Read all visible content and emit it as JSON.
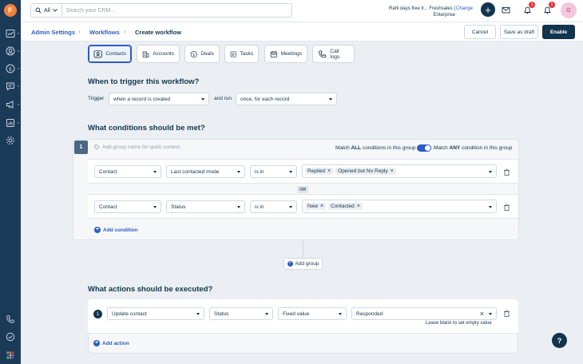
{
  "app": {
    "logo_letter": "F"
  },
  "topbar": {
    "search_scope": "All",
    "search_placeholder": "Search your CRM...",
    "trial_line1": "Rahi days free tr...",
    "trial_line2": "Freshsales |",
    "trial_line3": "Enterprise",
    "change_label": "Change",
    "plus_label": "+",
    "notifications_badge": "1",
    "alerts_badge": "1",
    "avatar_initial": "G"
  },
  "breadcrumb": {
    "admin_settings": "Admin Settings",
    "workflows": "Workflows",
    "current": "Create workflow",
    "sep": "›"
  },
  "header_buttons": {
    "cancel": "Cancel",
    "save_draft": "Save as draft",
    "enable": "Enable"
  },
  "modules": [
    {
      "label": "Contacts",
      "icon": "contacts-icon"
    },
    {
      "label": "Accounts",
      "icon": "accounts-icon"
    },
    {
      "label": "Deals",
      "icon": "deals-icon"
    },
    {
      "label": "Tasks",
      "icon": "tasks-icon"
    },
    {
      "label": "Meetings",
      "icon": "meetings-icon"
    },
    {
      "label": "Call logs",
      "icon": "call-logs-icon"
    }
  ],
  "trigger": {
    "title": "When to trigger this workflow?",
    "trigger_label": "Trigger",
    "trigger_value": "when a record is created",
    "run_label": "and run",
    "run_value": "once, for each record"
  },
  "conditions": {
    "title": "What conditions should be met?",
    "group_number": "1",
    "group_name_placeholder": "Add group name for quick context",
    "match_all_prefix": "Match",
    "match_all_bold": "ALL",
    "match_all_suffix": "conditions in this group",
    "match_any_prefix": "Match",
    "match_any_bold": "ANY",
    "match_any_suffix": "condition in this group",
    "or_label": "OR",
    "rows": [
      {
        "module": "Contact",
        "field": "Last contacted mode",
        "operator": "is in",
        "values": [
          "Replied",
          "Opened but No Reply"
        ]
      },
      {
        "module": "Contact",
        "field": "Status",
        "operator": "is in",
        "values": [
          "New",
          "Contacted"
        ]
      }
    ],
    "add_condition": "Add condition",
    "add_group": "Add group"
  },
  "actions": {
    "title": "What actions should be executed?",
    "step_number": "1",
    "action": "Update contact",
    "field": "Status",
    "value_type": "Fixed value",
    "value": "Responded",
    "hint": "Leave blank to set empty value",
    "add_action": "Add action"
  },
  "help_label": "?"
}
